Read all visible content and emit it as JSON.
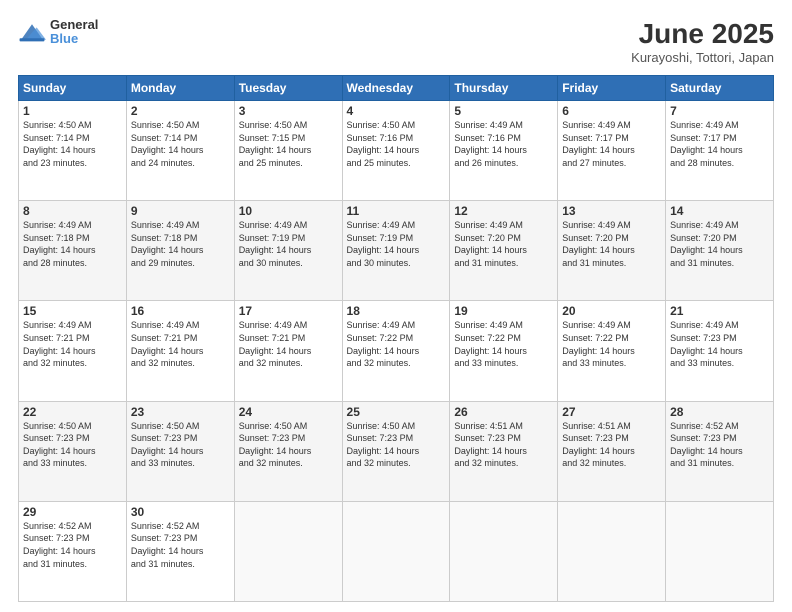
{
  "app": {
    "logo_line1": "General",
    "logo_line2": "Blue"
  },
  "title": "June 2025",
  "subtitle": "Kurayoshi, Tottori, Japan",
  "headers": [
    "Sunday",
    "Monday",
    "Tuesday",
    "Wednesday",
    "Thursday",
    "Friday",
    "Saturday"
  ],
  "weeks": [
    [
      {
        "day": "1",
        "info": "Sunrise: 4:50 AM\nSunset: 7:14 PM\nDaylight: 14 hours\nand 23 minutes."
      },
      {
        "day": "2",
        "info": "Sunrise: 4:50 AM\nSunset: 7:14 PM\nDaylight: 14 hours\nand 24 minutes."
      },
      {
        "day": "3",
        "info": "Sunrise: 4:50 AM\nSunset: 7:15 PM\nDaylight: 14 hours\nand 25 minutes."
      },
      {
        "day": "4",
        "info": "Sunrise: 4:50 AM\nSunset: 7:16 PM\nDaylight: 14 hours\nand 25 minutes."
      },
      {
        "day": "5",
        "info": "Sunrise: 4:49 AM\nSunset: 7:16 PM\nDaylight: 14 hours\nand 26 minutes."
      },
      {
        "day": "6",
        "info": "Sunrise: 4:49 AM\nSunset: 7:17 PM\nDaylight: 14 hours\nand 27 minutes."
      },
      {
        "day": "7",
        "info": "Sunrise: 4:49 AM\nSunset: 7:17 PM\nDaylight: 14 hours\nand 28 minutes."
      }
    ],
    [
      {
        "day": "8",
        "info": "Sunrise: 4:49 AM\nSunset: 7:18 PM\nDaylight: 14 hours\nand 28 minutes."
      },
      {
        "day": "9",
        "info": "Sunrise: 4:49 AM\nSunset: 7:18 PM\nDaylight: 14 hours\nand 29 minutes."
      },
      {
        "day": "10",
        "info": "Sunrise: 4:49 AM\nSunset: 7:19 PM\nDaylight: 14 hours\nand 30 minutes."
      },
      {
        "day": "11",
        "info": "Sunrise: 4:49 AM\nSunset: 7:19 PM\nDaylight: 14 hours\nand 30 minutes."
      },
      {
        "day": "12",
        "info": "Sunrise: 4:49 AM\nSunset: 7:20 PM\nDaylight: 14 hours\nand 31 minutes."
      },
      {
        "day": "13",
        "info": "Sunrise: 4:49 AM\nSunset: 7:20 PM\nDaylight: 14 hours\nand 31 minutes."
      },
      {
        "day": "14",
        "info": "Sunrise: 4:49 AM\nSunset: 7:20 PM\nDaylight: 14 hours\nand 31 minutes."
      }
    ],
    [
      {
        "day": "15",
        "info": "Sunrise: 4:49 AM\nSunset: 7:21 PM\nDaylight: 14 hours\nand 32 minutes."
      },
      {
        "day": "16",
        "info": "Sunrise: 4:49 AM\nSunset: 7:21 PM\nDaylight: 14 hours\nand 32 minutes."
      },
      {
        "day": "17",
        "info": "Sunrise: 4:49 AM\nSunset: 7:21 PM\nDaylight: 14 hours\nand 32 minutes."
      },
      {
        "day": "18",
        "info": "Sunrise: 4:49 AM\nSunset: 7:22 PM\nDaylight: 14 hours\nand 32 minutes."
      },
      {
        "day": "19",
        "info": "Sunrise: 4:49 AM\nSunset: 7:22 PM\nDaylight: 14 hours\nand 33 minutes."
      },
      {
        "day": "20",
        "info": "Sunrise: 4:49 AM\nSunset: 7:22 PM\nDaylight: 14 hours\nand 33 minutes."
      },
      {
        "day": "21",
        "info": "Sunrise: 4:49 AM\nSunset: 7:23 PM\nDaylight: 14 hours\nand 33 minutes."
      }
    ],
    [
      {
        "day": "22",
        "info": "Sunrise: 4:50 AM\nSunset: 7:23 PM\nDaylight: 14 hours\nand 33 minutes."
      },
      {
        "day": "23",
        "info": "Sunrise: 4:50 AM\nSunset: 7:23 PM\nDaylight: 14 hours\nand 33 minutes."
      },
      {
        "day": "24",
        "info": "Sunrise: 4:50 AM\nSunset: 7:23 PM\nDaylight: 14 hours\nand 32 minutes."
      },
      {
        "day": "25",
        "info": "Sunrise: 4:50 AM\nSunset: 7:23 PM\nDaylight: 14 hours\nand 32 minutes."
      },
      {
        "day": "26",
        "info": "Sunrise: 4:51 AM\nSunset: 7:23 PM\nDaylight: 14 hours\nand 32 minutes."
      },
      {
        "day": "27",
        "info": "Sunrise: 4:51 AM\nSunset: 7:23 PM\nDaylight: 14 hours\nand 32 minutes."
      },
      {
        "day": "28",
        "info": "Sunrise: 4:52 AM\nSunset: 7:23 PM\nDaylight: 14 hours\nand 31 minutes."
      }
    ],
    [
      {
        "day": "29",
        "info": "Sunrise: 4:52 AM\nSunset: 7:23 PM\nDaylight: 14 hours\nand 31 minutes."
      },
      {
        "day": "30",
        "info": "Sunrise: 4:52 AM\nSunset: 7:23 PM\nDaylight: 14 hours\nand 31 minutes."
      },
      {
        "day": "",
        "info": ""
      },
      {
        "day": "",
        "info": ""
      },
      {
        "day": "",
        "info": ""
      },
      {
        "day": "",
        "info": ""
      },
      {
        "day": "",
        "info": ""
      }
    ]
  ]
}
